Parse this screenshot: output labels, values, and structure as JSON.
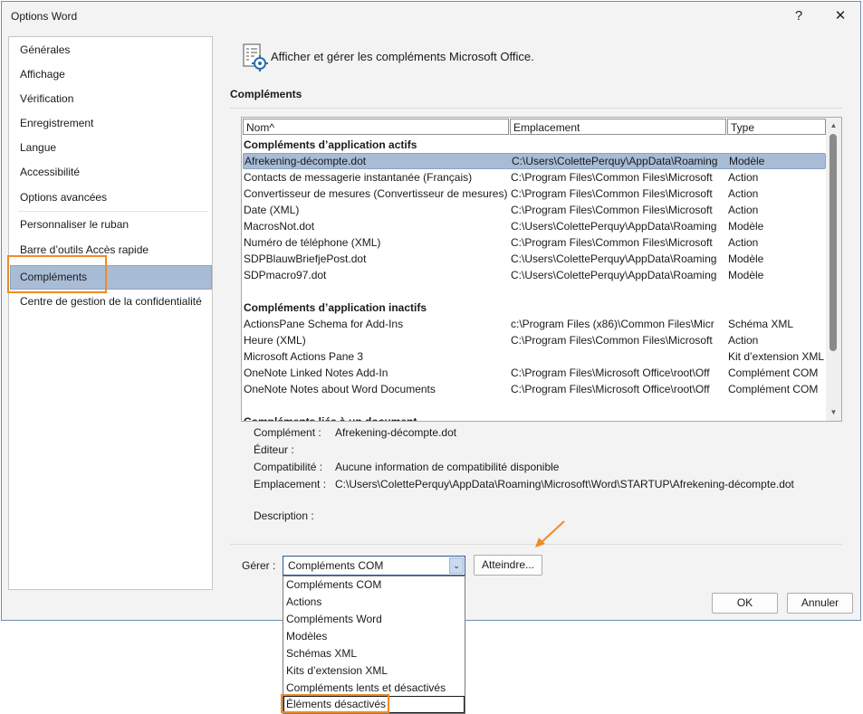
{
  "window": {
    "title": "Options Word",
    "help": "?",
    "close": "✕"
  },
  "sidebar": {
    "items": [
      {
        "label": "Générales"
      },
      {
        "label": "Affichage"
      },
      {
        "label": "Vérification"
      },
      {
        "label": "Enregistrement"
      },
      {
        "label": "Langue"
      },
      {
        "label": "Accessibilité"
      },
      {
        "label": "Options avancées"
      },
      {
        "label": "Personnaliser le ruban"
      },
      {
        "label": "Barre d’outils Accès rapide"
      },
      {
        "label": "Compléments"
      },
      {
        "label": "Centre de gestion de la confidentialité"
      }
    ],
    "selected": "Compléments"
  },
  "header": {
    "text": "Afficher et gérer les compléments Microsoft Office.",
    "icon": "addins-gear-icon"
  },
  "section": {
    "title": "Compléments"
  },
  "table": {
    "columns": {
      "name": "Nom",
      "name_sort": "^",
      "location": "Emplacement",
      "type": "Type"
    },
    "groups": [
      {
        "title": "Compléments d’application actifs",
        "rows": [
          {
            "name": "Afrekening-décompte.dot",
            "location": "C:\\Users\\ColettePerquy\\AppData\\Roaming",
            "type": "Modèle"
          },
          {
            "name": "Contacts de messagerie instantanée (Français)",
            "location": "C:\\Program Files\\Common Files\\Microsoft",
            "type": "Action"
          },
          {
            "name": "Convertisseur de mesures (Convertisseur de mesures)",
            "location": "C:\\Program Files\\Common Files\\Microsoft",
            "type": "Action"
          },
          {
            "name": "Date (XML)",
            "location": "C:\\Program Files\\Common Files\\Microsoft",
            "type": "Action"
          },
          {
            "name": "MacrosNot.dot",
            "location": "C:\\Users\\ColettePerquy\\AppData\\Roaming",
            "type": "Modèle"
          },
          {
            "name": "Numéro de téléphone (XML)",
            "location": "C:\\Program Files\\Common Files\\Microsoft",
            "type": "Action"
          },
          {
            "name": "SDPBlauwBriefjePost.dot",
            "location": "C:\\Users\\ColettePerquy\\AppData\\Roaming",
            "type": "Modèle"
          },
          {
            "name": "SDPmacro97.dot",
            "location": "C:\\Users\\ColettePerquy\\AppData\\Roaming",
            "type": "Modèle"
          }
        ]
      },
      {
        "title": "Compléments d’application inactifs",
        "rows": [
          {
            "name": "ActionsPane Schema for Add-Ins",
            "location": "c:\\Program Files (x86)\\Common Files\\Micr",
            "type": "Schéma XML"
          },
          {
            "name": "Heure (XML)",
            "location": "C:\\Program Files\\Common Files\\Microsoft",
            "type": "Action"
          },
          {
            "name": "Microsoft Actions Pane 3",
            "location": "",
            "type": "Kit d’extension XML"
          },
          {
            "name": "OneNote Linked Notes Add-In",
            "location": "C:\\Program Files\\Microsoft Office\\root\\Off",
            "type": "Complément COM"
          },
          {
            "name": "OneNote Notes about Word Documents",
            "location": "C:\\Program Files\\Microsoft Office\\root\\Off",
            "type": "Complément COM"
          }
        ]
      },
      {
        "title": "Compléments liés à un document",
        "rows": []
      }
    ]
  },
  "details": {
    "addin_label": "Complément :",
    "addin_value": "Afrekening-décompte.dot",
    "publisher_label": "Éditeur :",
    "publisher_value": "",
    "compat_label": "Compatibilité :",
    "compat_value": "Aucune information de compatibilité disponible",
    "location_label": "Emplacement :",
    "location_value": "C:\\Users\\ColettePerquy\\AppData\\Roaming\\Microsoft\\Word\\STARTUP\\Afrekening-décompte.dot",
    "description_label": "Description :"
  },
  "manage": {
    "label": "Gérer :",
    "selected": "Compléments COM",
    "options": [
      "Compléments COM",
      "Actions",
      "Compléments Word",
      "Modèles",
      "Schémas XML",
      "Kits d’extension XML",
      "Compléments lents et désactivés",
      "Éléments désactivés"
    ],
    "go_button": "Atteindre..."
  },
  "footer": {
    "ok": "OK",
    "cancel": "Annuler"
  },
  "colors": {
    "accent": "#f08a24",
    "selection": "#a8bcd6",
    "border": "#2b5797"
  }
}
